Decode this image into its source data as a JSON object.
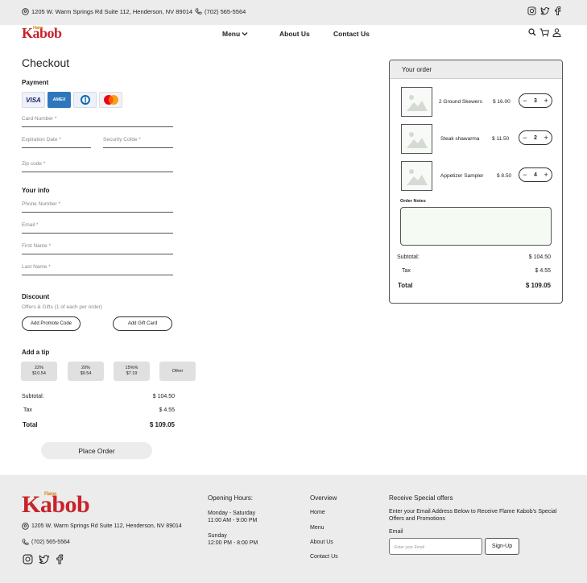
{
  "topbar": {
    "address": "1205 W. Warm Springs Rd Suite 112, Henderson, NV 89014",
    "phone": "(702) 565-5564"
  },
  "brand": {
    "logo_main": "Kabob",
    "logo_small": "Flame"
  },
  "nav": {
    "menu": "Menu",
    "about": "About Us",
    "contact": "Contact Us"
  },
  "checkout": {
    "title": "Checkout",
    "payment_heading": "Payment",
    "cards": [
      "VISA",
      "AMEX"
    ],
    "fields": {
      "card_number": "Card Number *",
      "expiration": "Expiration Date *",
      "security": "Security Cofde *",
      "zip": "Zip code *"
    },
    "info_heading": "Your info",
    "info_fields": {
      "phone": "Phone Number *",
      "email": "Email *",
      "first": "First Name *",
      "last": "Last Name *"
    },
    "discount_heading": "Discount",
    "discount_sub": "Offers & Gifts (1 of each per order)",
    "promo_button": "Add Promote Code",
    "gift_button": "Add Gift Card",
    "tip_heading": "Add a tip",
    "tips": [
      {
        "pct": "22%",
        "amt": "$10.54"
      },
      {
        "pct": "20%",
        "amt": "$9.54"
      },
      {
        "pct": "15%%",
        "amt": "$7.19"
      }
    ],
    "tip_other": "Other",
    "summary": {
      "subtotal_label": "Subtotal:",
      "subtotal": "$ 104.50",
      "tax_label": "Tax",
      "tax": "$ 4.55",
      "total_label": "Total",
      "total": "$ 109.05"
    },
    "place_order": "Place Order"
  },
  "order": {
    "heading": "Your order",
    "items": [
      {
        "name": "2 Ground Skewers",
        "price": "$ 16.00",
        "qty": "3"
      },
      {
        "name": "Steak shawarma",
        "price": "$ 11.50",
        "qty": "2"
      },
      {
        "name": "Appetizer Sampler",
        "price": "$ 8.50",
        "qty": "4"
      }
    ],
    "notes_label": "Order Notes",
    "summary": {
      "subtotal_label": "Subtotal:",
      "subtotal": "$ 104.50",
      "tax_label": "Tax",
      "tax": "$ 4.55",
      "total_label": "Total",
      "total": "$ 109.05"
    }
  },
  "footer": {
    "address": "1205 W. Warm Springs Rd Suite 112, Henderson, NV 89014",
    "phone": "(702) 565-5564",
    "hours_heading": "Opening Hours:",
    "hours_weekday_days": "Monday - Saturday",
    "hours_weekday_time": "11:00 AM - 9:00 PM",
    "hours_sunday_day": "Sunday",
    "hours_sunday_time": "12:00 PM - 8:00 PM",
    "overview_heading": "Overview",
    "links": [
      "Home",
      "Menu",
      "About Us",
      "Contact Us"
    ],
    "offers_heading": "Receive Special offers",
    "offers_text": "Enter your Email Address Below to Receive Flame Kabob's Special Offers and Promotions",
    "email_label": "Email",
    "email_placeholder": "Enter your Email",
    "signup": "Sign-Up"
  }
}
